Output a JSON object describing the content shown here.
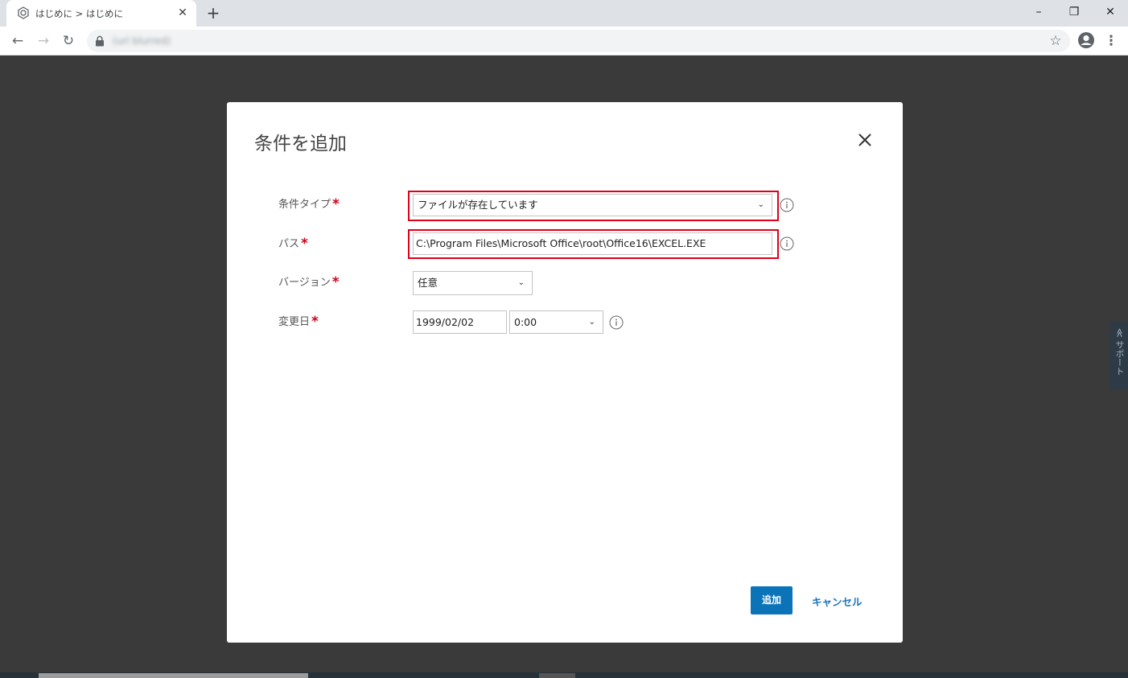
{
  "browser": {
    "tab_title": "はじめに > はじめに",
    "url": "(url blurred)"
  },
  "support_tab": {
    "label": "≪ サポート"
  },
  "dialog": {
    "title": "条件を追加",
    "fields": {
      "condition_type": {
        "label": "条件タイプ",
        "value": "ファイルが存在しています"
      },
      "path": {
        "label": "パス",
        "value": "C:\\Program Files\\Microsoft Office\\root\\Office16\\EXCEL.EXE"
      },
      "version": {
        "label": "バージョン",
        "value": "任意"
      },
      "modified_date": {
        "label": "変更日",
        "date": "1999/02/02",
        "time": "0:00"
      }
    },
    "required_mark": "*",
    "buttons": {
      "add": "追加",
      "cancel": "キャンセル"
    }
  },
  "colors": {
    "primary": "#0b73b8",
    "highlight": "#e0001b",
    "required": "#d0021b",
    "overlay": "#3a3a3a"
  }
}
